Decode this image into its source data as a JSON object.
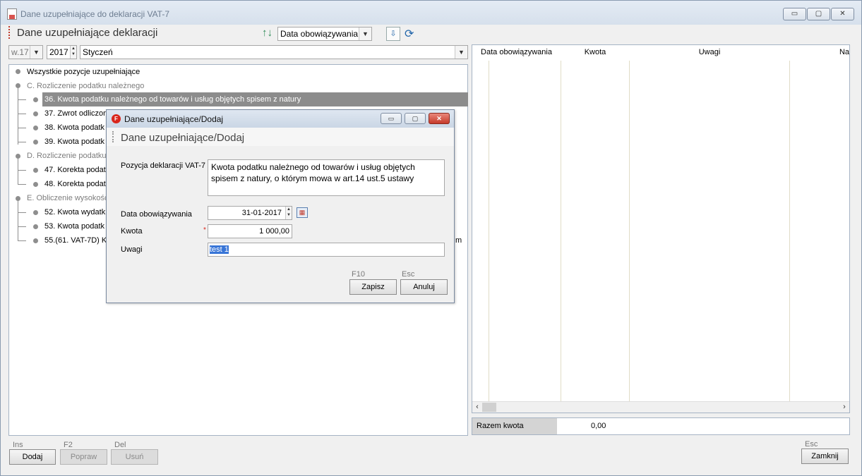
{
  "window": {
    "title": "Dane uzupełniające do deklaracji VAT-7",
    "controls": [
      "▭",
      "▢",
      "✕"
    ]
  },
  "header": {
    "title": "Dane uzupełniające deklaracji",
    "sort_combo_value": "Data obowiązywania"
  },
  "filters": {
    "version": "w.17",
    "year": "2017",
    "month": "Styczeń"
  },
  "tree": {
    "root": "Wszystkie pozycje uzupełniające",
    "groups": [
      {
        "label": "C. Rozliczenie podatku należnego",
        "items": [
          "36. Kwota podatku należnego od towarów i usług objętych spisem z natury",
          "37. Zwrot odliczon",
          "38. Kwota podatk",
          "39. Kwota podatk"
        ]
      },
      {
        "label": "D. Rozliczenie podatku",
        "items": [
          "47. Korekta podat",
          "48. Korekta podat"
        ]
      },
      {
        "label": "E. Obliczenie wysokośc",
        "items": [
          "52. Kwota wydatk",
          "53. Kwota podatk",
          "55.(61. VAT-7D) K"
        ]
      }
    ],
    "overflow_fragment": "m"
  },
  "grid": {
    "columns": [
      "Data obowiązywania",
      "Kwota",
      "Uwagi",
      "Na"
    ],
    "rows": []
  },
  "summary": {
    "label": "Razem kwota",
    "value": "0,00"
  },
  "actions": {
    "add_key": "Ins",
    "add_label": "Dodaj",
    "edit_key": "F2",
    "edit_label": "Popraw",
    "delete_key": "Del",
    "delete_label": "Usuń",
    "close_key": "Esc",
    "close_label": "Zamknij"
  },
  "dialog": {
    "title": "Dane uzupełniające/Dodaj",
    "header": "Dane uzupełniające/Dodaj",
    "logo_letter": "F",
    "position_label": "Pozycja deklaracji VAT-7",
    "position_value": "Kwota podatku należnego od towarów i usług objętych spisem z natury, o którym mowa w art.14 ust.5 ustawy",
    "date_label": "Data obowiązywania",
    "date_value": "31-01-2017",
    "amount_label": "Kwota",
    "amount_required": "*",
    "amount_value": "1 000,00",
    "notes_label": "Uwagi",
    "notes_value": "test 1",
    "save_key": "F10",
    "save_label": "Zapisz",
    "cancel_key": "Esc",
    "cancel_label": "Anuluj"
  }
}
